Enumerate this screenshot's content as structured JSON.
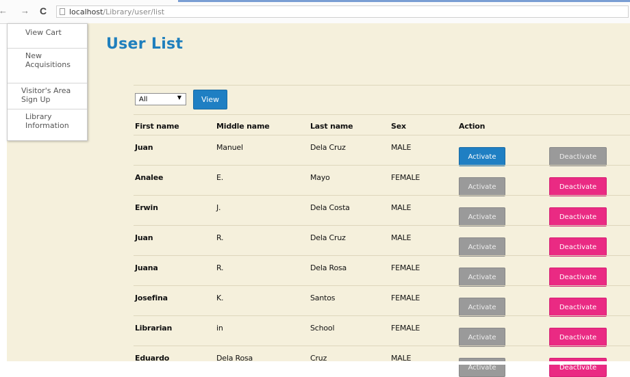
{
  "browser": {
    "back_icon": "←",
    "forward_icon": "→",
    "reload_icon": "C",
    "url_host": "localhost",
    "url_path": "/Library/user/list"
  },
  "sidebar": {
    "items": [
      {
        "label": "View Cart"
      },
      {
        "label": "New Acquisitions"
      },
      {
        "label": "Visitor's Area Sign Up"
      },
      {
        "label": "Library Information"
      }
    ]
  },
  "page": {
    "title": "User List"
  },
  "filter": {
    "selected": "All",
    "view_label": "View"
  },
  "table": {
    "headers": [
      "First name",
      "Middle name",
      "Last name",
      "Sex",
      "Action"
    ],
    "rows": [
      {
        "first": "Juan",
        "middle": "Manuel",
        "last": "Dela Cruz",
        "sex": "MALE",
        "activate": "Activate",
        "deactivate": "Deactivate",
        "active_state": "activate"
      },
      {
        "first": "Analee",
        "middle": "E.",
        "last": "Mayo",
        "sex": "FEMALE",
        "activate": "Activate",
        "deactivate": "Deactivate",
        "active_state": "deactivate"
      },
      {
        "first": "Erwin",
        "middle": "J.",
        "last": "Dela Costa",
        "sex": "MALE",
        "activate": "Activate",
        "deactivate": "Deactivate",
        "active_state": "deactivate"
      },
      {
        "first": "Juan",
        "middle": "R.",
        "last": "Dela Cruz",
        "sex": "MALE",
        "activate": "Activate",
        "deactivate": "Deactivate",
        "active_state": "deactivate"
      },
      {
        "first": "Juana",
        "middle": "R.",
        "last": "Dela Rosa",
        "sex": "FEMALE",
        "activate": "Activate",
        "deactivate": "Deactivate",
        "active_state": "deactivate"
      },
      {
        "first": "Josefina",
        "middle": "K.",
        "last": "Santos",
        "sex": "FEMALE",
        "activate": "Activate",
        "deactivate": "Deactivate",
        "active_state": "deactivate"
      },
      {
        "first": "Librarian",
        "middle": "in",
        "last": "School",
        "sex": "FEMALE",
        "activate": "Activate",
        "deactivate": "Deactivate",
        "active_state": "deactivate"
      },
      {
        "first": "Eduardo",
        "middle": "Dela Rosa",
        "last": "Cruz",
        "sex": "MALE",
        "activate": "Activate",
        "deactivate": "Deactivate",
        "active_state": "deactivate"
      }
    ]
  },
  "colors": {
    "page_bg": "#f5f0dc",
    "title": "#1f7fbd",
    "activate_blue": "#1f7fc3",
    "deactivate_pink": "#ea2a83",
    "disabled_gray": "#9a9a9a"
  }
}
